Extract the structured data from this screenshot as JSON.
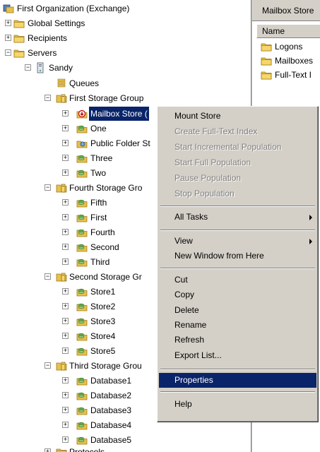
{
  "tree": {
    "root": "First Organization (Exchange)",
    "global_settings": "Global Settings",
    "recipients": "Recipients",
    "servers": "Servers",
    "sandy": "Sandy",
    "queues": "Queues",
    "sg1": "First Storage Group",
    "sg1_items": [
      "Mailbox Store (",
      "One",
      "Public Folder St",
      "Three",
      "Two"
    ],
    "sg2": "Fourth Storage Gro",
    "sg2_items": [
      "Fifth",
      "First",
      "Fourth",
      "Second",
      "Third"
    ],
    "sg3": "Second Storage Gr",
    "sg3_items": [
      "Store1",
      "Store2",
      "Store3",
      "Store4",
      "Store5"
    ],
    "sg4": "Third Storage Grou",
    "sg4_items": [
      "Database1",
      "Database2",
      "Database3",
      "Database4",
      "Database5"
    ],
    "protocols": "Protocols"
  },
  "right_pane": {
    "title": "Mailbox Store",
    "column": "Name",
    "items": [
      "Logons",
      "Mailboxes",
      "Full-Text I"
    ]
  },
  "menu": {
    "mount_store": "Mount Store",
    "create_index": "Create Full-Text Index",
    "start_incremental": "Start Incremental Population",
    "start_full": "Start Full Population",
    "pause": "Pause Population",
    "stop": "Stop Population",
    "all_tasks": "All Tasks",
    "view": "View",
    "new_window": "New Window from Here",
    "cut": "Cut",
    "copy": "Copy",
    "delete": "Delete",
    "rename": "Rename",
    "refresh": "Refresh",
    "export_list": "Export List...",
    "properties": "Properties",
    "help": "Help"
  },
  "colors": {
    "selection": "#0a246a",
    "menu_bg": "#d4d0c8",
    "disabled_text": "#808080"
  }
}
